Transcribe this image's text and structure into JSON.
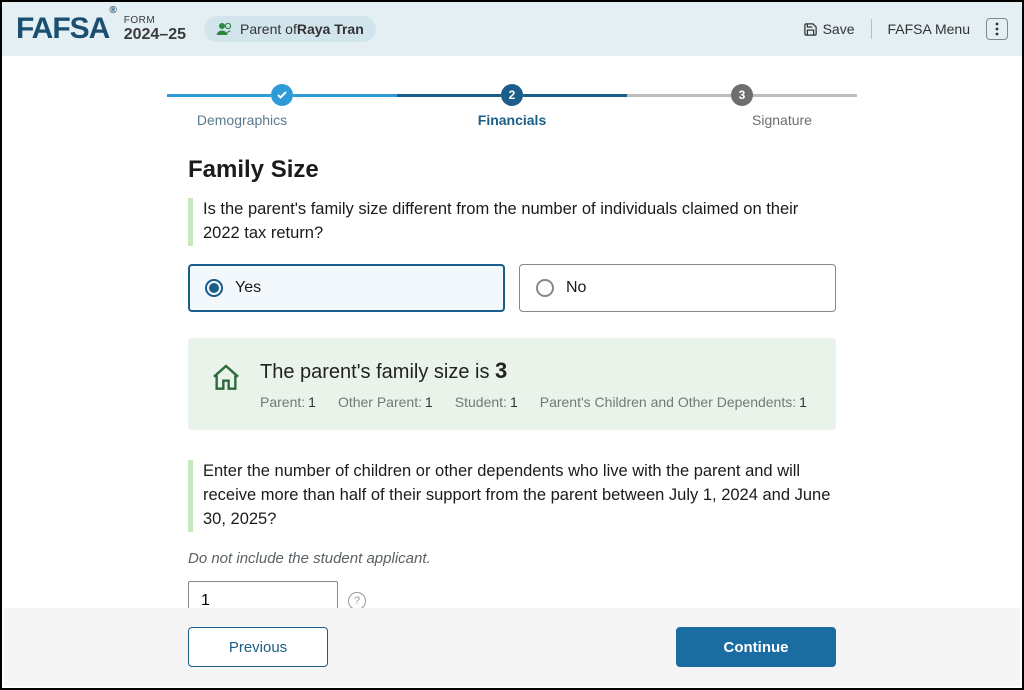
{
  "header": {
    "logo_text": "FAFSA",
    "logo_reg": "®",
    "form_label": "FORM",
    "year": "2024–25",
    "parent_prefix": "Parent of ",
    "student_name": "Raya Tran",
    "save_label": "Save",
    "menu_label": "FAFSA Menu"
  },
  "stepper": {
    "steps": [
      {
        "label": "Demographics",
        "state": "done"
      },
      {
        "label": "Financials",
        "state": "active",
        "num": "2"
      },
      {
        "label": "Signature",
        "state": "todo",
        "num": "3"
      }
    ]
  },
  "page": {
    "title": "Family Size",
    "q1": "Is the parent's family size different from the number of individuals claimed on their 2022 tax return?",
    "options": {
      "yes": "Yes",
      "no": "No"
    },
    "selected": "yes",
    "summary_prefix": "The parent's family size is ",
    "summary_value": "3",
    "breakdown": {
      "parent_label": "Parent:",
      "parent_val": "1",
      "other_parent_label": "Other Parent:",
      "other_parent_val": "1",
      "student_label": "Student:",
      "student_val": "1",
      "dependents_label": "Parent's Children and Other Dependents:",
      "dependents_val": "1"
    },
    "q2": "Enter the number of children or other dependents who live with the parent and will receive more than half of their support from the parent between July 1, 2024 and June 30, 2025?",
    "note": "Do not include the student applicant.",
    "dependents_input": "1"
  },
  "footer": {
    "previous": "Previous",
    "continue": "Continue"
  }
}
